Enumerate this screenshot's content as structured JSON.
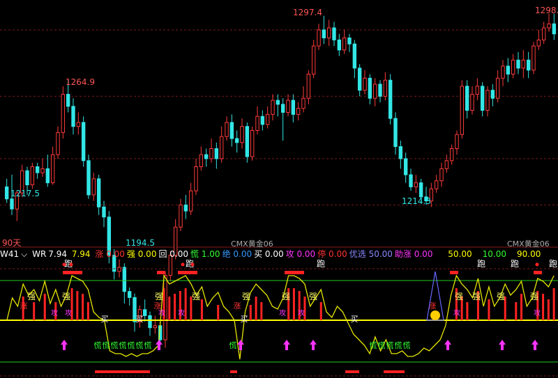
{
  "chart_data": {
    "type": "candlestick",
    "price_labels": {
      "high_left": "1264.9",
      "high_mid": "1297.4",
      "high_right": "1298.",
      "low_1": "1217.5",
      "low_2": "1194.5",
      "low_3": "1214.3"
    },
    "period_label": "90天",
    "contract_labels": [
      "CMX黄金06",
      "CMX黄金06"
    ],
    "candles": [
      [
        1212,
        1206,
        1216,
        1204
      ],
      [
        1206,
        1201,
        1218,
        1198
      ],
      [
        1201,
        1209,
        1210,
        1195
      ],
      [
        1209,
        1220,
        1223,
        1207
      ],
      [
        1220,
        1213,
        1222,
        1208
      ],
      [
        1213,
        1222,
        1224,
        1211
      ],
      [
        1222,
        1219,
        1224,
        1216
      ],
      [
        1219,
        1221,
        1226,
        1217
      ],
      [
        1221,
        1214,
        1228,
        1212
      ],
      [
        1214,
        1228,
        1232,
        1213
      ],
      [
        1228,
        1239,
        1242,
        1226
      ],
      [
        1239,
        1258,
        1262,
        1236
      ],
      [
        1258,
        1252,
        1265,
        1249
      ],
      [
        1252,
        1242,
        1256,
        1238
      ],
      [
        1242,
        1244,
        1249,
        1238
      ],
      [
        1244,
        1225,
        1247,
        1222
      ],
      [
        1225,
        1208,
        1228,
        1206
      ],
      [
        1208,
        1216,
        1219,
        1205
      ],
      [
        1216,
        1202,
        1218,
        1198
      ],
      [
        1202,
        1197,
        1205,
        1192
      ],
      [
        1197,
        1178,
        1200,
        1174
      ],
      [
        1178,
        1170,
        1181,
        1166
      ],
      [
        1170,
        1172,
        1176,
        1167
      ],
      [
        1172,
        1160,
        1174,
        1154
      ],
      [
        1160,
        1157,
        1162,
        1153
      ],
      [
        1157,
        1145,
        1159,
        1140
      ],
      [
        1145,
        1151,
        1153,
        1142
      ],
      [
        1151,
        1148,
        1156,
        1145
      ],
      [
        1148,
        1142,
        1150,
        1138
      ],
      [
        1142,
        1143,
        1148,
        1139
      ],
      [
        1143,
        1136,
        1145,
        1134
      ],
      [
        1136,
        1168,
        1170,
        1132
      ],
      [
        1168,
        1178,
        1180,
        1165
      ],
      [
        1178,
        1192,
        1196,
        1176
      ],
      [
        1192,
        1203,
        1206,
        1190
      ],
      [
        1203,
        1200,
        1208,
        1196
      ],
      [
        1200,
        1210,
        1214,
        1198
      ],
      [
        1210,
        1222,
        1226,
        1208
      ],
      [
        1222,
        1228,
        1232,
        1220
      ],
      [
        1228,
        1226,
        1231,
        1222
      ],
      [
        1226,
        1231,
        1236,
        1224
      ],
      [
        1231,
        1226,
        1234,
        1221
      ],
      [
        1226,
        1237,
        1242,
        1224
      ],
      [
        1237,
        1244,
        1247,
        1235
      ],
      [
        1244,
        1236,
        1248,
        1232
      ],
      [
        1236,
        1234,
        1240,
        1229
      ],
      [
        1234,
        1242,
        1246,
        1231
      ],
      [
        1242,
        1227,
        1244,
        1224
      ],
      [
        1227,
        1240,
        1242,
        1225
      ],
      [
        1240,
        1247,
        1252,
        1238
      ],
      [
        1247,
        1243,
        1250,
        1240
      ],
      [
        1243,
        1248,
        1252,
        1241
      ],
      [
        1248,
        1255,
        1258,
        1245
      ],
      [
        1255,
        1253,
        1258,
        1247
      ],
      [
        1253,
        1249,
        1256,
        1235
      ],
      [
        1249,
        1255,
        1258,
        1247
      ],
      [
        1255,
        1248,
        1258,
        1244
      ],
      [
        1248,
        1251,
        1254,
        1245
      ],
      [
        1251,
        1256,
        1262,
        1249
      ],
      [
        1256,
        1268,
        1270,
        1253
      ],
      [
        1268,
        1282,
        1285,
        1266
      ],
      [
        1282,
        1290,
        1293,
        1280
      ],
      [
        1290,
        1286,
        1297,
        1283
      ],
      [
        1286,
        1291,
        1295,
        1282
      ],
      [
        1291,
        1285,
        1294,
        1282
      ],
      [
        1285,
        1280,
        1288,
        1277
      ],
      [
        1280,
        1286,
        1290,
        1278
      ],
      [
        1286,
        1283,
        1288,
        1279
      ],
      [
        1283,
        1271,
        1285,
        1266
      ],
      [
        1271,
        1260,
        1273,
        1257
      ],
      [
        1260,
        1266,
        1270,
        1258
      ],
      [
        1266,
        1256,
        1268,
        1253
      ],
      [
        1256,
        1263,
        1266,
        1252
      ],
      [
        1263,
        1257,
        1265,
        1254
      ],
      [
        1257,
        1265,
        1269,
        1255
      ],
      [
        1265,
        1246,
        1268,
        1243
      ],
      [
        1246,
        1232,
        1249,
        1228
      ],
      [
        1232,
        1226,
        1235,
        1221
      ],
      [
        1226,
        1218,
        1229,
        1214
      ],
      [
        1218,
        1212,
        1221,
        1210
      ],
      [
        1212,
        1214,
        1218,
        1209
      ],
      [
        1214,
        1207,
        1216,
        1204
      ],
      [
        1207,
        1205,
        1212,
        1203
      ],
      [
        1205,
        1211,
        1214,
        1202
      ],
      [
        1211,
        1215,
        1218,
        1209
      ],
      [
        1215,
        1221,
        1224,
        1212
      ],
      [
        1221,
        1225,
        1228,
        1219
      ],
      [
        1225,
        1231,
        1233,
        1223
      ],
      [
        1231,
        1238,
        1240,
        1228
      ],
      [
        1238,
        1262,
        1265,
        1236
      ],
      [
        1262,
        1250,
        1265,
        1246
      ],
      [
        1250,
        1258,
        1262,
        1248
      ],
      [
        1258,
        1262,
        1266,
        1255
      ],
      [
        1262,
        1250,
        1264,
        1247
      ],
      [
        1250,
        1260,
        1262,
        1247
      ],
      [
        1260,
        1256,
        1263,
        1252
      ],
      [
        1256,
        1266,
        1270,
        1254
      ],
      [
        1266,
        1272,
        1275,
        1262
      ],
      [
        1272,
        1268,
        1276,
        1264
      ],
      [
        1268,
        1275,
        1278,
        1266
      ],
      [
        1275,
        1271,
        1279,
        1268
      ],
      [
        1271,
        1275,
        1280,
        1266
      ],
      [
        1275,
        1270,
        1279,
        1266
      ],
      [
        1270,
        1282,
        1284,
        1268
      ],
      [
        1282,
        1285,
        1290,
        1280
      ],
      [
        1285,
        1291,
        1294,
        1283
      ],
      [
        1291,
        1293,
        1298,
        1289
      ],
      [
        1293,
        1288,
        1298,
        1285
      ]
    ],
    "wr_values": [
      15,
      55,
      40,
      80,
      60,
      70,
      50,
      85,
      45,
      70,
      40,
      60,
      95,
      90,
      85,
      70,
      30,
      20,
      15,
      -40,
      -45,
      -45,
      -50,
      -45,
      -50,
      -45,
      -45,
      -40,
      -30,
      95,
      80,
      85,
      90,
      95,
      80,
      60,
      75,
      40,
      55,
      65,
      40,
      30,
      15,
      -55,
      30,
      65,
      80,
      70,
      60,
      40,
      35,
      55,
      95,
      95,
      90,
      80,
      40,
      55,
      70,
      30,
      20,
      40,
      30,
      10,
      -10,
      -20,
      -30,
      -45,
      -15,
      -40,
      -20,
      -45,
      -45,
      -40,
      -50,
      -50,
      -45,
      -35,
      -40,
      -30,
      -20,
      5,
      60,
      95,
      80,
      70,
      55,
      90,
      40,
      75,
      40,
      55,
      80,
      60,
      70,
      85,
      40,
      55,
      90,
      85,
      75,
      95
    ],
    "indicator": {
      "name": "W41",
      "wr_label": "WR",
      "wr_value": "7.94",
      "v1": "7.94",
      "items": [
        {
          "label": "涨",
          "value": "0.00",
          "color": "#ff3333"
        },
        {
          "label": "强",
          "value": "0.00",
          "color": "#ffff00"
        },
        {
          "label": "回",
          "value": "0.00",
          "color": "#ffffff"
        },
        {
          "label": "慌",
          "value": "1.00",
          "color": "#33ff33"
        },
        {
          "label": "绝",
          "value": "0.00",
          "color": "#3399ff"
        },
        {
          "label": "买",
          "value": "0.00",
          "color": "#ffffff"
        },
        {
          "label": "攻",
          "value": "0.00",
          "color": "#ff33ff"
        },
        {
          "label": "停",
          "value": "0.00",
          "color": "#ff3333"
        },
        {
          "label": "优选",
          "value": "50.00",
          "color": "#8888ff"
        },
        {
          "label": "助涨",
          "value": "0.00",
          "color": "#ff33ff"
        }
      ],
      "extra_values": [
        {
          "value": "50.00",
          "color": "#ffff00"
        },
        {
          "value": "10.00",
          "color": "#33ff33"
        },
        {
          "value": "90.00",
          "color": "#ffff00"
        }
      ]
    },
    "signals": {
      "pao": "跑",
      "qiang": "强",
      "zhang": "涨",
      "mai": "买",
      "huang": "慌",
      "gong": "攻",
      "huang_groups": [
        [
          17,
          22
        ],
        [
          61,
          66
        ]
      ]
    }
  }
}
